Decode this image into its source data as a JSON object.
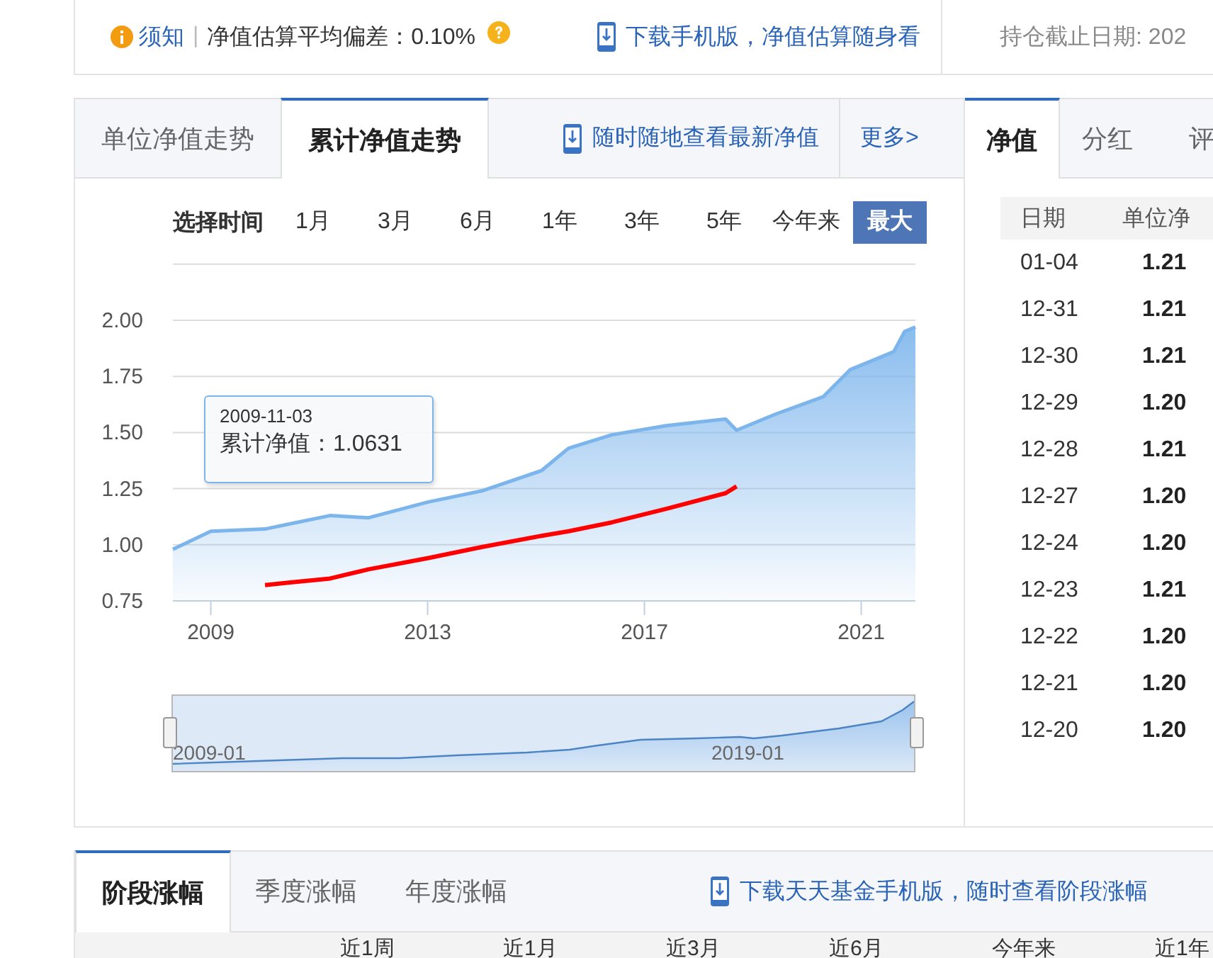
{
  "notice_bar": {
    "notice_link": "须知",
    "separator": "|",
    "deviation_text": "净值估算平均偏差：0.10%",
    "app_link": "下载手机版，净值估算随身看",
    "holding_date": "持仓截止日期: 202"
  },
  "chart_panel": {
    "tabs": [
      {
        "label": "单位净值走势",
        "selected": false
      },
      {
        "label": "累计净值走势",
        "selected": true
      }
    ],
    "app_link": "随时随地查看最新净值",
    "more_link": "更多>",
    "range_label": "选择时间",
    "ranges": [
      {
        "label": "1月",
        "selected": false
      },
      {
        "label": "3月",
        "selected": false
      },
      {
        "label": "6月",
        "selected": false
      },
      {
        "label": "1年",
        "selected": false
      },
      {
        "label": "3年",
        "selected": false
      },
      {
        "label": "5年",
        "selected": false
      },
      {
        "label": "今年来",
        "selected": false
      },
      {
        "label": "最大",
        "selected": true
      }
    ],
    "tooltip": {
      "date": "2009-11-03",
      "value": "累计净值：1.0631"
    },
    "chart_data": {
      "type": "line",
      "x": [
        2008.3,
        2009,
        2010,
        2010.4,
        2011.2,
        2011.9,
        2013,
        2014,
        2015.1,
        2015.6,
        2016.4,
        2017.4,
        2018.5,
        2018.7,
        2019.4,
        2020.3,
        2020.8,
        2021.6,
        2021.8,
        2022
      ],
      "series": [
        {
          "type": "area",
          "color": "#7cb5ec",
          "values": [
            0.98,
            1.06,
            1.07,
            1.09,
            1.13,
            1.12,
            1.19,
            1.24,
            1.33,
            1.43,
            1.49,
            1.53,
            1.56,
            1.51,
            1.58,
            1.66,
            1.78,
            1.86,
            1.95,
            1.97
          ]
        },
        {
          "color": "#ff0000",
          "values": [
            null,
            null,
            0.82,
            0.83,
            0.85,
            0.89,
            0.94,
            0.99,
            1.04,
            1.06,
            1.1,
            1.16,
            1.23,
            1.26,
            null,
            null,
            null,
            null,
            null,
            null
          ]
        }
      ],
      "grid": true,
      "xlim": [
        2008.3,
        2022
      ],
      "ylim": [
        0.75,
        2.25
      ],
      "xticks": [
        2009,
        2013,
        2017,
        2021
      ],
      "yticks": [
        {
          "value": 0.75,
          "label": "0.75"
        },
        {
          "value": 1,
          "label": "1.00"
        },
        {
          "value": 1.25,
          "label": "1.25"
        },
        {
          "value": 1.5,
          "label": "1.50"
        },
        {
          "value": 1.75,
          "label": "1.75"
        },
        {
          "value": 2,
          "label": "2.00"
        }
      ]
    },
    "navigator": {
      "start_label": "2009-01",
      "end_label": "2019-01"
    }
  },
  "nav_panel": {
    "tabs": [
      {
        "label": "净值",
        "selected": true
      },
      {
        "label": "分红",
        "selected": false
      },
      {
        "label": "评",
        "selected": false
      }
    ],
    "columns": [
      "日期",
      "单位净"
    ],
    "rows": [
      [
        "01-04",
        "1.21"
      ],
      [
        "12-31",
        "1.21"
      ],
      [
        "12-30",
        "1.21"
      ],
      [
        "12-29",
        "1.20"
      ],
      [
        "12-28",
        "1.21"
      ],
      [
        "12-27",
        "1.20"
      ],
      [
        "12-24",
        "1.20"
      ],
      [
        "12-23",
        "1.21"
      ],
      [
        "12-22",
        "1.20"
      ],
      [
        "12-21",
        "1.20"
      ],
      [
        "12-20",
        "1.20"
      ]
    ]
  },
  "returns_panel": {
    "tabs": [
      {
        "label": "阶段涨幅",
        "selected": true
      },
      {
        "label": "季度涨幅",
        "selected": false
      },
      {
        "label": "年度涨幅",
        "selected": false
      }
    ],
    "app_link": "下载天天基金手机版，随时查看阶段涨幅",
    "columns": [
      "近1周",
      "近1月",
      "近3月",
      "近6月",
      "今年来",
      "近1年"
    ]
  }
}
